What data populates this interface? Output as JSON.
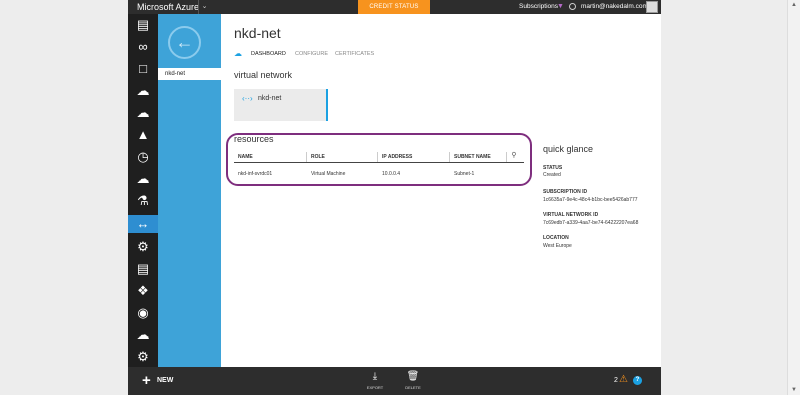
{
  "topbar": {
    "brand": "Microsoft Azure",
    "credit_status": "CREDIT STATUS",
    "subscriptions": "Subscriptions",
    "user": "martin@nakedalm.com"
  },
  "subnav": {
    "selected_item": "nkd-net"
  },
  "page": {
    "title": "nkd-net",
    "tabs": [
      "DASHBOARD",
      "CONFIGURE",
      "CERTIFICATES"
    ]
  },
  "virtual_network": {
    "heading": "virtual network",
    "tile_label": "nkd-net"
  },
  "resources": {
    "heading": "resources",
    "columns": [
      "NAME",
      "ROLE",
      "IP ADDRESS",
      "SUBNET NAME"
    ],
    "rows": [
      {
        "name": "nkd-inf-svrdc01",
        "role": "Virtual Machine",
        "ip": "10.0.0.4",
        "subnet": "Subnet-1"
      }
    ]
  },
  "quick_glance": {
    "heading": "quick glance",
    "status_label": "STATUS",
    "status_value": "Created",
    "subscription_label": "SUBSCRIPTION ID",
    "subscription_value": "1c6635a7-9e4c-48c4-b1bc-bee5426ab777",
    "vnet_id_label": "VIRTUAL NETWORK ID",
    "vnet_id_value": "7c69edb7-a339-4aa7-be74-64222207ea68",
    "location_label": "LOCATION",
    "location_value": "West Europe"
  },
  "bottombar": {
    "new_label": "NEW",
    "export_label": "EXPORT",
    "delete_label": "DELETE",
    "notification_count": "2",
    "help_label": "?"
  },
  "colors": {
    "accent": "#3ea3d8",
    "credit": "#f7931e",
    "highlight": "#7e2e7e"
  },
  "icons": {
    "nav": [
      "all-items-icon",
      "visual-studio-icon",
      "mobile-services-icon",
      "cloud-services-icon",
      "websites-icon",
      "hdinsight-icon",
      "scheduler-icon",
      "storage-icon",
      "machine-learning-icon",
      "networks-icon",
      "traffic-manager-icon",
      "media-services-icon",
      "service-bus-icon",
      "biztalk-icon",
      "cloud-storage-icon",
      "settings-icon"
    ]
  }
}
